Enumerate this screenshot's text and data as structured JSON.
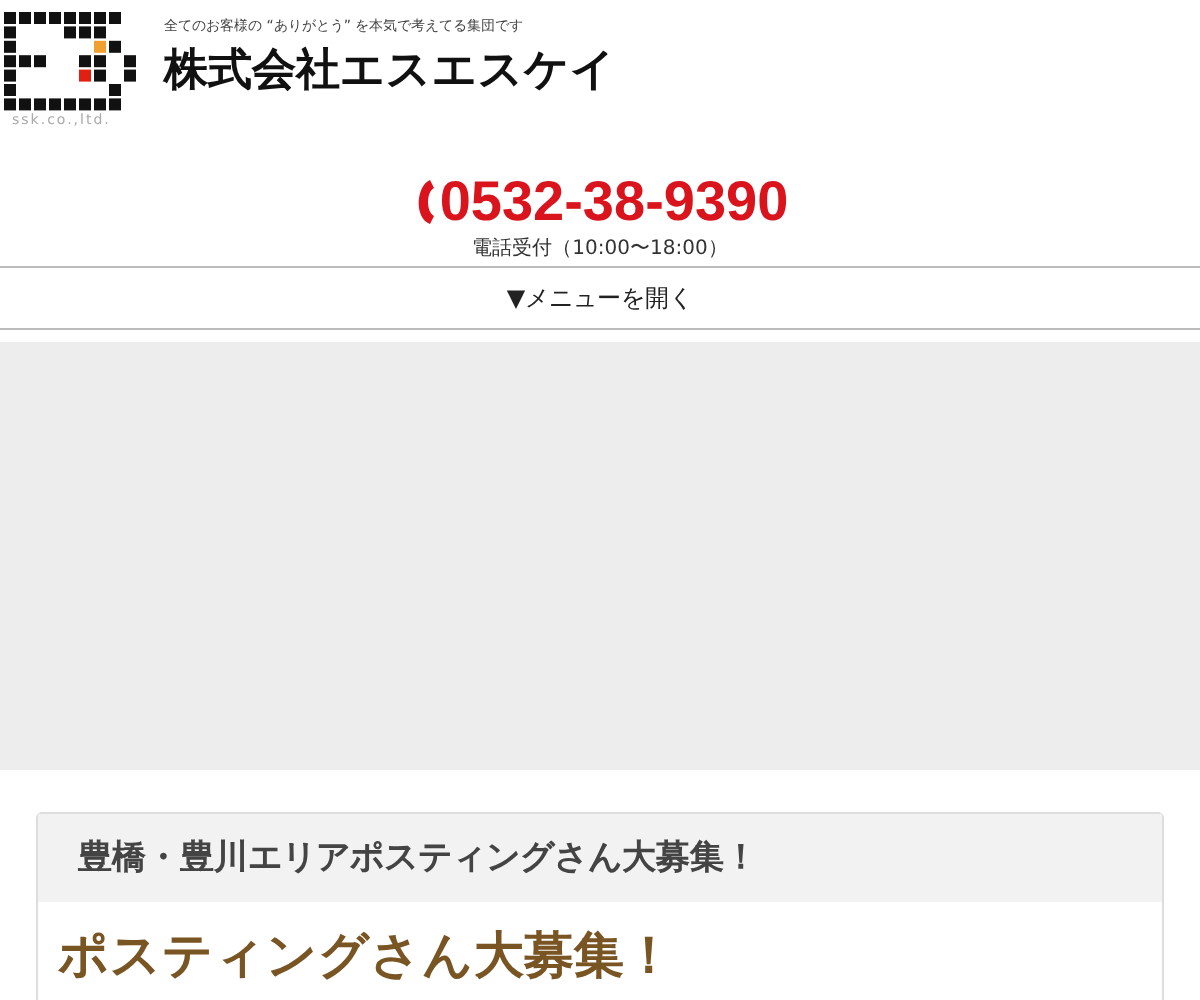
{
  "header": {
    "logo_caption": "ssk.co.,ltd.",
    "tagline": "全てのお客様の “ありがとう” を本気で考えてる集団です",
    "company": "株式会社エスエスケイ"
  },
  "contact": {
    "phone": "0532-38-9390",
    "hours": "電話受付（10:00〜18:00）"
  },
  "menu_toggle": {
    "label": "▼メニューを開く",
    "expanded": false
  },
  "banner": {
    "kind": "empty"
  },
  "card": {
    "title": "豊橋・豊川エリアポスティングさん大募集！",
    "heading": "ポスティングさん大募集！"
  }
}
